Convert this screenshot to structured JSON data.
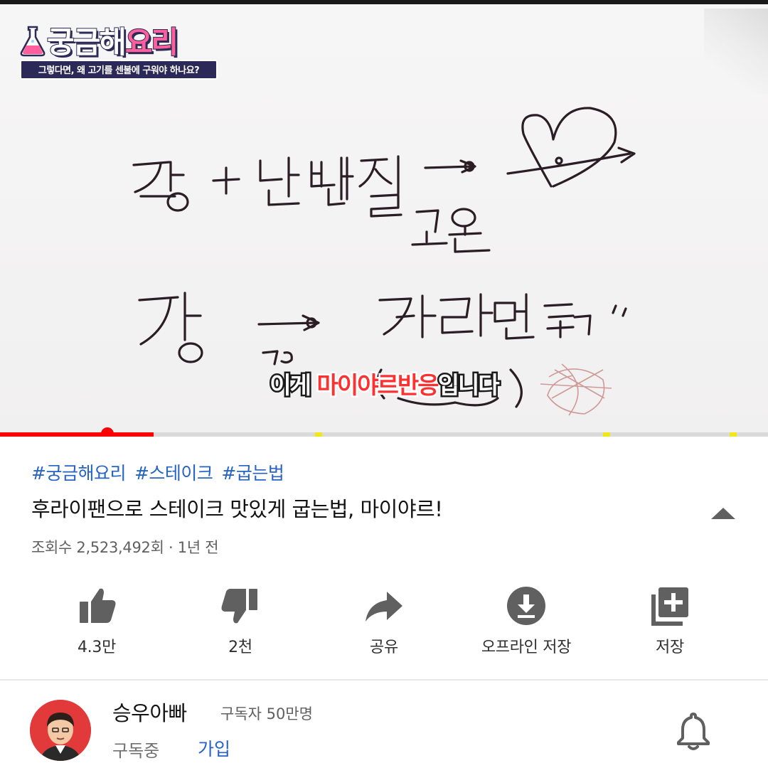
{
  "video": {
    "logo_title_part1": "궁금해",
    "logo_title_part2": "요리",
    "logo_subtitle": "그렇다면, 왜 고기를 센불에 구워야 하나요?",
    "subtitle_prefix": "이게 ",
    "subtitle_highlight": "마이야르반응",
    "subtitle_suffix": "입니다",
    "progress_fraction": 0.2,
    "ad_marker_fractions": [
      0.41,
      0.785,
      0.95
    ]
  },
  "hashtags": [
    "#궁금해요리",
    "#스테이크",
    "#굽는법"
  ],
  "title": "후라이팬으로 스테이크 맛있게 굽는법, 마이야르!",
  "meta": "조회수 2,523,492회 · 1년 전",
  "actions": {
    "like": "4.3만",
    "dislike": "2천",
    "share": "공유",
    "download": "오프라인 저장",
    "save": "저장"
  },
  "channel": {
    "name": "승우아빠",
    "subscribers": "구독자 50만명",
    "subscribed_label": "구독중",
    "join_label": "가입"
  },
  "colors": {
    "accent_red": "#ff0000",
    "link_blue": "#2563c6",
    "icon_gray": "#606060"
  },
  "icons": [
    "like-icon",
    "dislike-icon",
    "share-icon",
    "download-icon",
    "save-playlist-icon",
    "collapse-icon",
    "bell-icon"
  ]
}
